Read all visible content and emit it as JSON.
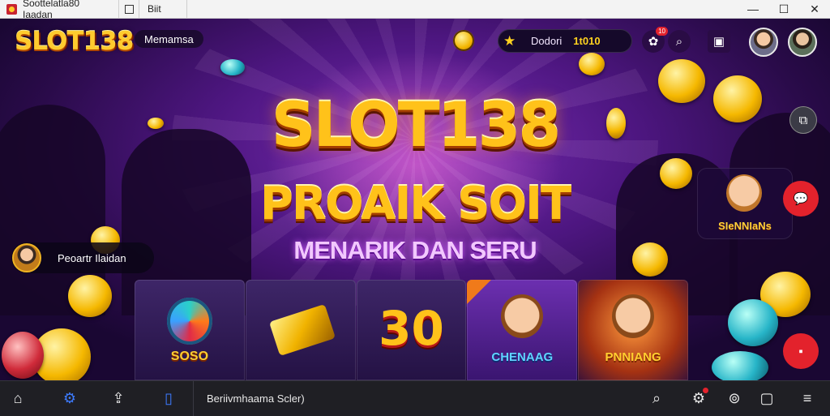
{
  "window": {
    "title": "Soottelatla80 Iaadan",
    "tab2": "Biit",
    "controls": [
      "—",
      "☐",
      "✕"
    ]
  },
  "header": {
    "logo": "SLOT138",
    "menu_label": "Memamsa",
    "wallet_name": "Dodori",
    "wallet_balance": "1t010",
    "notif_count": "10"
  },
  "hero": {
    "headline": "SLOT138",
    "subheadline": "PROAIK SOIT",
    "tagline": "MENARIK DAN SERU"
  },
  "player_pill": {
    "label": "Peoartr Ilaidan"
  },
  "featured_character": {
    "label": "SIeNNIaNs"
  },
  "tiles": [
    {
      "label": "SOSO"
    },
    {
      "label": ""
    },
    {
      "label": "30"
    },
    {
      "label": "CHENAAG"
    },
    {
      "label": "PNNIANG"
    }
  ],
  "taskbar": {
    "active_label": "Beriivmhaama Scler)"
  },
  "icons": {
    "home": "home-icon",
    "settings": "gear-icon",
    "share": "share-icon",
    "app": "window-icon",
    "search": "search-icon",
    "location": "location-icon",
    "chat": "chat-icon",
    "menu": "menu-icon"
  },
  "colors": {
    "accent_gold": "#ffc21a",
    "brand_purple": "#4d1680",
    "taskbar": "#1f1f24",
    "alert_red": "#e3222c"
  }
}
